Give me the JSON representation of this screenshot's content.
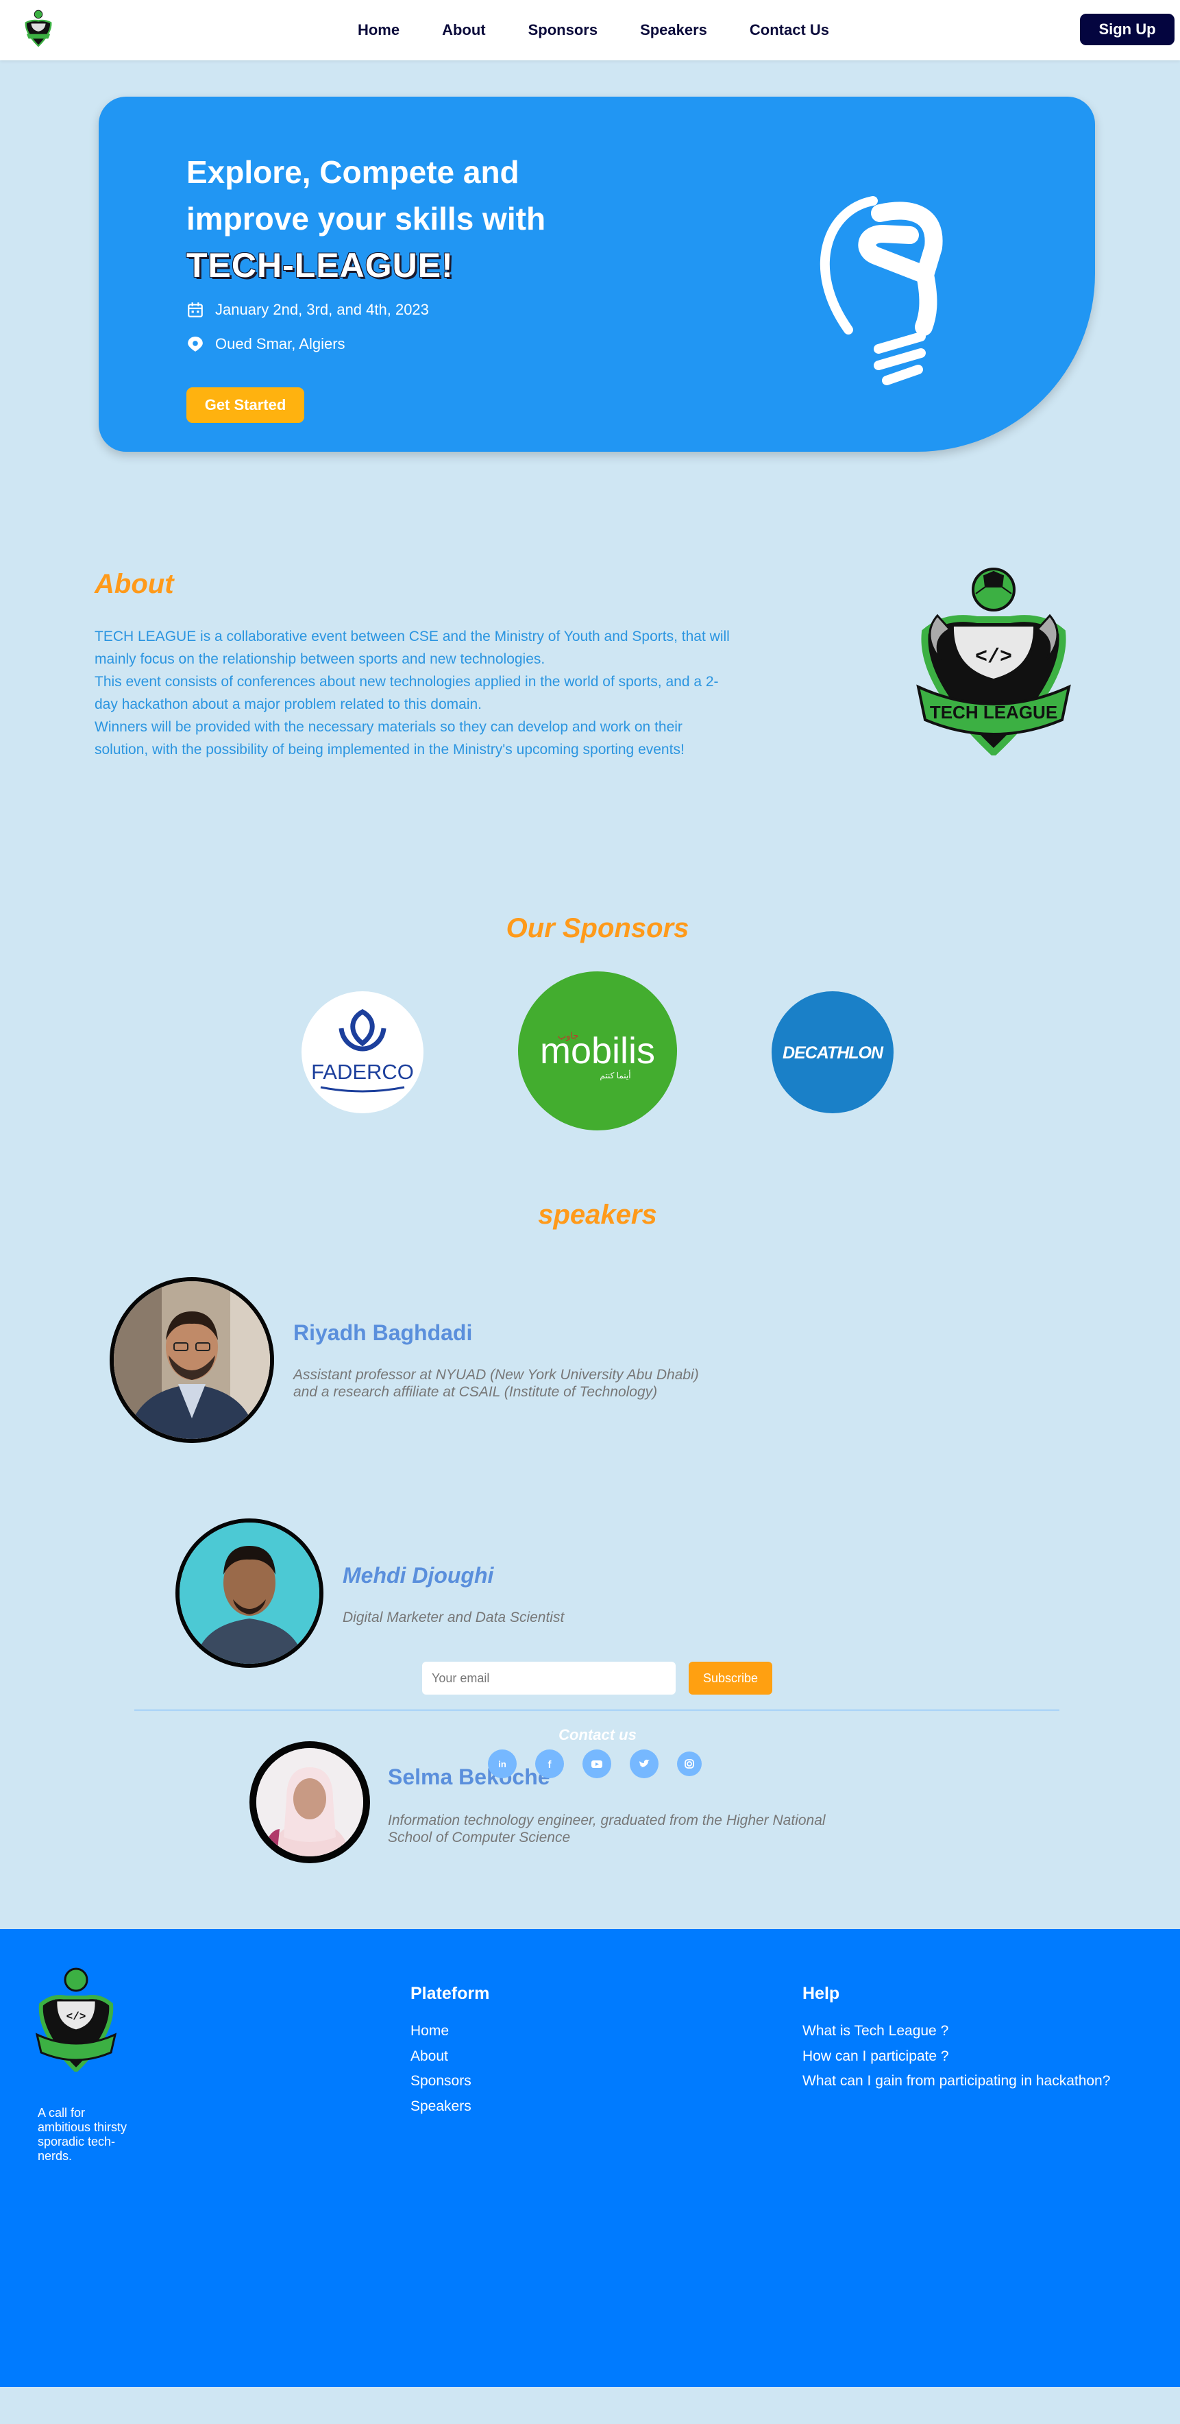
{
  "nav": {
    "links": [
      "Home",
      "About",
      "Sponsors",
      "Speakers",
      "Contact Us"
    ],
    "signup_label": "Sign Up"
  },
  "hero": {
    "title_line1": "Explore, Compete and",
    "title_line2": "improve your skills with",
    "title_brand": "TECH-LEAGUE!",
    "date": "January 2nd, 3rd, and 4th, 2023",
    "location": "Oued Smar, Algiers",
    "cta_label": "Get Started"
  },
  "about": {
    "title": "About",
    "paragraphs": [
      "TECH LEAGUE is a collaborative event between CSE and the Ministry of Youth and Sports, that will mainly focus on the relationship between sports and new technologies.",
      "This event consists of conferences about new technologies applied in the world of sports, and a 2-day hackathon about a major problem related to this domain.",
      "Winners will be provided with the necessary materials so they can develop and work on their solution, with the possibility of being implemented in the Ministry's upcoming sporting events!"
    ],
    "logo_text": "TECH LEAGUE"
  },
  "sponsors": {
    "title": "Our Sponsors",
    "items": [
      {
        "name": "FADERCO",
        "color": "#1c3f9c"
      },
      {
        "name": "mobilis",
        "color": "#43ad2f",
        "sub": "جاوب",
        "tagline": "أينما كنتم"
      },
      {
        "name": "DECATHLON",
        "color": "#1a80c8"
      }
    ]
  },
  "speakers": {
    "title": "speakers",
    "items": [
      {
        "name": "Riyadh Baghdadi",
        "desc_line1": "Assistant professor at NYUAD (New York University Abu Dhabi)",
        "desc_line2": "and a research affiliate at CSAIL (Institute of Technology)"
      },
      {
        "name": "Mehdi Djoughi",
        "desc_line1": "Digital Marketer and Data Scientist",
        "desc_line2": ""
      },
      {
        "name": "Selma Bekoche",
        "desc_line1": "Information technology engineer, graduated from the Higher National",
        "desc_line2": "School of Computer Science"
      }
    ]
  },
  "footer": {
    "tagline": "A call for ambitious thirsty sporadic tech-nerds.",
    "platform_title": "Plateform",
    "platform_links": [
      "Home",
      "About",
      "Sponsors",
      "Speakers"
    ],
    "help_title": "Help",
    "help_links": [
      "What is Tech League ?",
      "How can I participate ?",
      "What can I gain from participating in hackathon?"
    ],
    "email_placeholder": "Your email",
    "subscribe_label": "Subscribe",
    "contact_title": "Contact us",
    "socials": [
      "linkedin-icon",
      "facebook-icon",
      "youtube-icon",
      "twitter-icon",
      "instagram-icon"
    ]
  },
  "colors": {
    "page_bg": "#cfe6f3",
    "hero_bg": "#2196f3",
    "accent_orange": "#ff9a1a",
    "footer_bg": "#007bff",
    "navy": "#04053f"
  }
}
